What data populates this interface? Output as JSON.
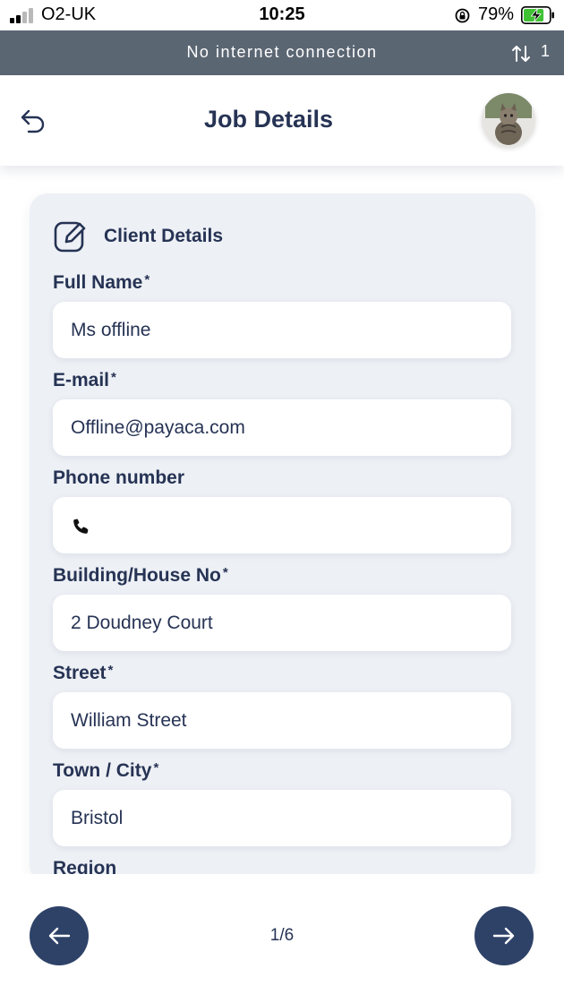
{
  "status_bar": {
    "carrier": "O2-UK",
    "time": "10:25",
    "battery_percent": "79%",
    "battery_level": 0.79,
    "signal_bars_filled": 2,
    "signal_bars_total": 4,
    "icons": [
      "cellular-signal-icon",
      "orientation-lock-icon",
      "battery-charging-icon"
    ]
  },
  "banner": {
    "text": "No internet connection",
    "sync_count": "1",
    "icon": "sync-arrows-icon"
  },
  "header": {
    "title": "Job Details",
    "back_icon": "undo-arrow-icon",
    "avatar": "user-avatar-cat"
  },
  "card": {
    "title": "Client Details",
    "icon": "edit-icon",
    "fields": {
      "full_name": {
        "label": "Full Name",
        "required_mark": "*",
        "value": "Ms offline"
      },
      "email": {
        "label": "E-mail",
        "required_mark": "*",
        "value": "Offline@payaca.com"
      },
      "phone": {
        "label": "Phone number",
        "value": "",
        "icon": "phone-icon"
      },
      "building": {
        "label": "Building/House No",
        "required_mark": "*",
        "value": "2 Doudney Court"
      },
      "street": {
        "label": "Street",
        "required_mark": "*",
        "value": "William Street"
      },
      "town": {
        "label": "Town / City",
        "required_mark": "*",
        "value": "Bristol"
      },
      "region": {
        "label": "Region"
      }
    }
  },
  "footer": {
    "page_indicator": "1/6",
    "prev_icon": "arrow-left-icon",
    "next_icon": "arrow-right-icon"
  },
  "colors": {
    "primary": "#263354",
    "nav_button": "#2e4268",
    "banner_bg": "#5b6673",
    "card_bg": "#edf0f5",
    "battery_green": "#3fc234"
  }
}
